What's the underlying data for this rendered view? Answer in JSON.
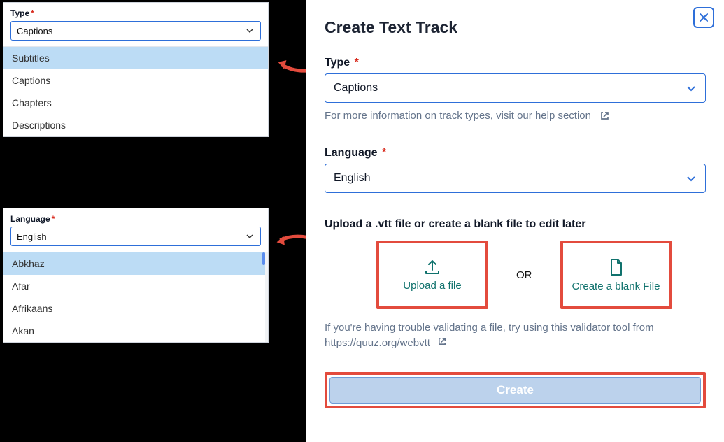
{
  "dialog": {
    "title": "Create Text Track",
    "type_label": "Type",
    "type_value": "Captions",
    "help_text": "For more information on track types, visit our help section",
    "language_label": "Language",
    "language_value": "English",
    "upload_heading": "Upload a .vtt file or create a blank file to edit later",
    "upload_btn": "Upload a file",
    "or_text": "OR",
    "blank_btn": "Create a blank File",
    "validator_note": "If you're having trouble validating a file, try using this validator tool from https://quuz.org/webvtt",
    "create_btn": "Create"
  },
  "type_dropdown": {
    "label": "Type",
    "selected": "Captions",
    "options": [
      "Subtitles",
      "Captions",
      "Chapters",
      "Descriptions"
    ],
    "highlight_index": 0
  },
  "lang_dropdown": {
    "label": "Language",
    "selected": "English",
    "options": [
      "Abkhaz",
      "Afar",
      "Afrikaans",
      "Akan"
    ],
    "highlight_index": 0
  }
}
